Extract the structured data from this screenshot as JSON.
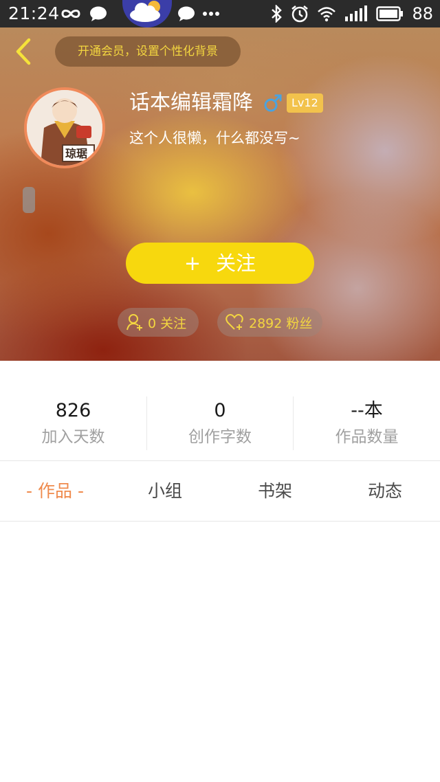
{
  "status_bar": {
    "time": "21:24",
    "battery": "88",
    "left_icons": [
      "infinity-icon",
      "chat-bubble-icon",
      "weather-cloud-icon",
      "chat-bubble-icon",
      "more-dots-icon"
    ],
    "right_icons": [
      "bluetooth-icon",
      "alarm-clock-icon",
      "wifi-icon",
      "signal-icon",
      "battery-icon"
    ]
  },
  "header": {
    "vip_banner": "开通会员，设置个性化背景",
    "username": "话本编辑霜降",
    "gender": "male",
    "level": "Lv12",
    "bio": "这个人很懒，什么都没写~",
    "follow_button": {
      "icon": "+",
      "label": "关注"
    },
    "following_pill": "0 关注",
    "fans_pill": "2892 粉丝"
  },
  "stats": [
    {
      "value": "826",
      "label": "加入天数"
    },
    {
      "value": "0",
      "label": "创作字数"
    },
    {
      "value": "--本",
      "label": "作品数量"
    }
  ],
  "tabs": [
    {
      "label": "- 作品 -",
      "active": true
    },
    {
      "label": "小组",
      "active": false
    },
    {
      "label": "书架",
      "active": false
    },
    {
      "label": "动态",
      "active": false
    }
  ],
  "colors": {
    "accent_yellow": "#f7d80e",
    "pill_text": "#f3d640",
    "active_tab": "#ef8a4c",
    "level_badge": "#f2c24c",
    "gender_blue": "#4aa3df"
  }
}
